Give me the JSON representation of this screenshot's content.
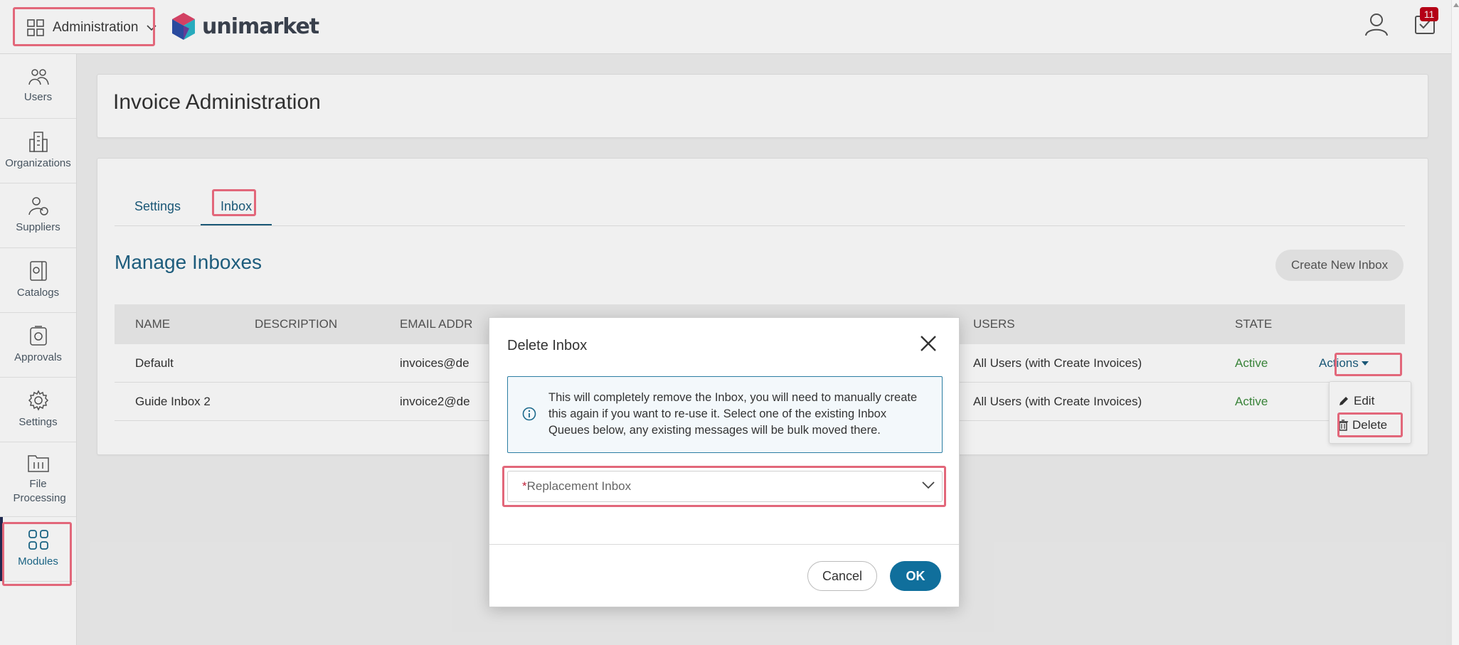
{
  "topbar": {
    "app_switcher_label": "Administration",
    "brand_name": "unimarket",
    "notification_count": "11"
  },
  "sidebar": {
    "items": [
      {
        "label": "Users",
        "icon": "users-icon"
      },
      {
        "label": "Organizations",
        "icon": "organizations-icon"
      },
      {
        "label": "Suppliers",
        "icon": "suppliers-icon"
      },
      {
        "label": "Catalogs",
        "icon": "catalogs-icon"
      },
      {
        "label": "Approvals",
        "icon": "approvals-icon"
      },
      {
        "label": "Settings",
        "icon": "settings-icon"
      },
      {
        "label": "File Processing",
        "icon": "file-processing-icon"
      },
      {
        "label": "Modules",
        "icon": "modules-icon"
      }
    ]
  },
  "page": {
    "title": "Invoice Administration",
    "tabs": [
      {
        "label": "Settings"
      },
      {
        "label": "Inbox",
        "active": true
      }
    ],
    "section_title": "Manage Inboxes",
    "create_button": "Create New Inbox"
  },
  "table": {
    "headers": [
      "NAME",
      "DESCRIPTION",
      "EMAIL ADDR",
      "USERS",
      "STATE"
    ],
    "rows": [
      {
        "name": "Default",
        "description": "",
        "email": "invoices@de",
        "users": "All Users (with Create Invoices)",
        "state": "Active",
        "action": "Actions"
      },
      {
        "name": "Guide Inbox 2",
        "description": "",
        "email": "invoice2@de",
        "users": "All Users (with Create Invoices)",
        "state": "Active"
      }
    ]
  },
  "actions_menu": {
    "edit": "Edit",
    "delete": "Delete"
  },
  "modal": {
    "title": "Delete Inbox",
    "info_text": "This will completely remove the Inbox, you will need to manually create this again if you want to re-use it. Select one of the existing Inbox Queues below, any existing messages will be bulk moved there.",
    "select_required_mark": "*",
    "select_placeholder": "Replacement Inbox",
    "cancel": "Cancel",
    "ok": "OK"
  },
  "colors": {
    "accent": "#106f9c",
    "highlight": "#e2677a",
    "active_state": "#3d8c3d",
    "badge": "#c00018"
  }
}
